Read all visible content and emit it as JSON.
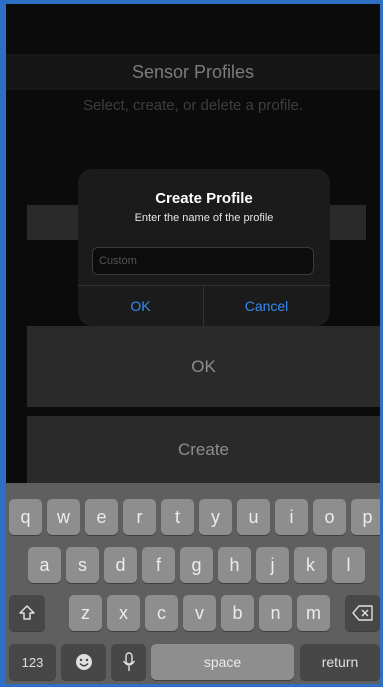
{
  "screen": {
    "title": "Sensor Profiles",
    "subtitle": "Select, create, or delete a profile."
  },
  "buttons": {
    "ok_label": "OK",
    "create_label": "Create"
  },
  "dialog": {
    "title": "Create Profile",
    "message": "Enter the name of the profile",
    "input_value": "",
    "input_placeholder": "Custom",
    "ok_label": "OK",
    "cancel_label": "Cancel"
  },
  "keyboard": {
    "row1": [
      "q",
      "w",
      "e",
      "r",
      "t",
      "y",
      "u",
      "i",
      "o",
      "p"
    ],
    "row2": [
      "a",
      "s",
      "d",
      "f",
      "g",
      "h",
      "j",
      "k",
      "l"
    ],
    "row3": [
      "z",
      "x",
      "c",
      "v",
      "b",
      "n",
      "m"
    ],
    "numbers_label": "123",
    "space_label": "space",
    "return_label": "return",
    "shift_icon": "shift-icon",
    "delete_icon": "delete-icon",
    "emoji_icon": "emoji-icon",
    "mic_icon": "microphone-icon"
  },
  "colors": {
    "accent": "#2f8cf2",
    "frame_border": "#2d6fc4"
  }
}
